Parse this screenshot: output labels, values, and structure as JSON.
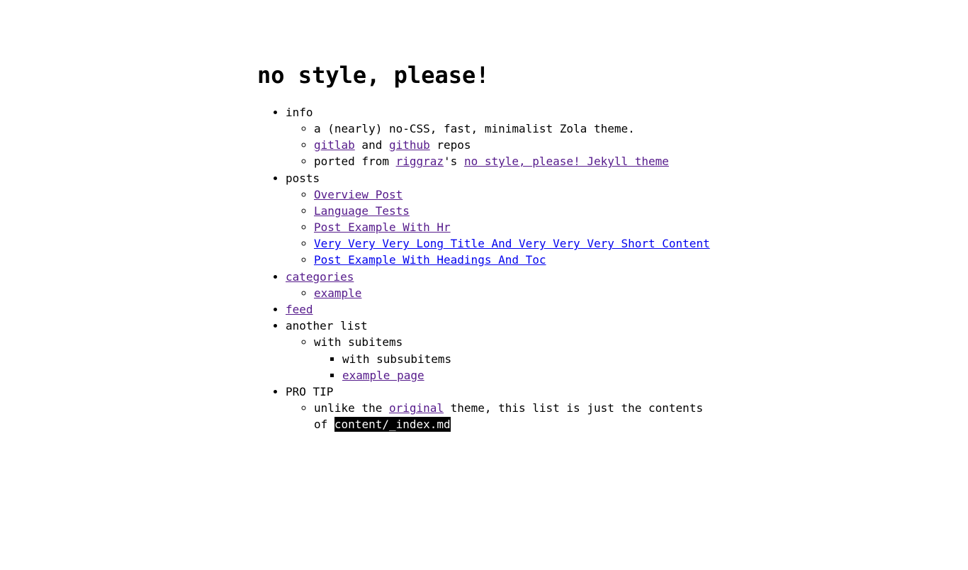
{
  "site": {
    "title": "no style, please!",
    "colors": {
      "background": "#ffffff",
      "text": "#000000",
      "link": "#0000ee",
      "link_visited": "#551a8b",
      "code_background": "#000000",
      "code_text": "#ffffff"
    }
  },
  "toc": {
    "info": {
      "label": "info",
      "tagline": "a (nearly) no-CSS, fast, minimalist Zola theme.",
      "repos": {
        "gitlab": "gitlab",
        "and": " and ",
        "github": "github",
        "suffix": " repos"
      },
      "ported": {
        "prefix": "ported from ",
        "author": "riggraz",
        "possessive": "'s ",
        "theme": "no style, please! Jekyll theme"
      }
    },
    "posts": {
      "label": "posts",
      "items": [
        "Overview Post",
        "Language Tests",
        "Post Example With Hr",
        "Very Very Very Long Title And Very Very Very Short Content",
        "Post Example With Headings And Toc"
      ]
    },
    "categories": {
      "label": "categories",
      "items": [
        "example"
      ]
    },
    "feed": {
      "label": "feed"
    },
    "another_list": {
      "label": "another list",
      "subitem": "with subitems",
      "subsubitem": "with subsubitems",
      "subsublink": "example page"
    },
    "pro_tip": {
      "label": "PRO TIP",
      "prefix": "unlike the ",
      "original": "original",
      "middle": " theme, this list is just the contents of ",
      "code": "content/_index.md"
    }
  }
}
